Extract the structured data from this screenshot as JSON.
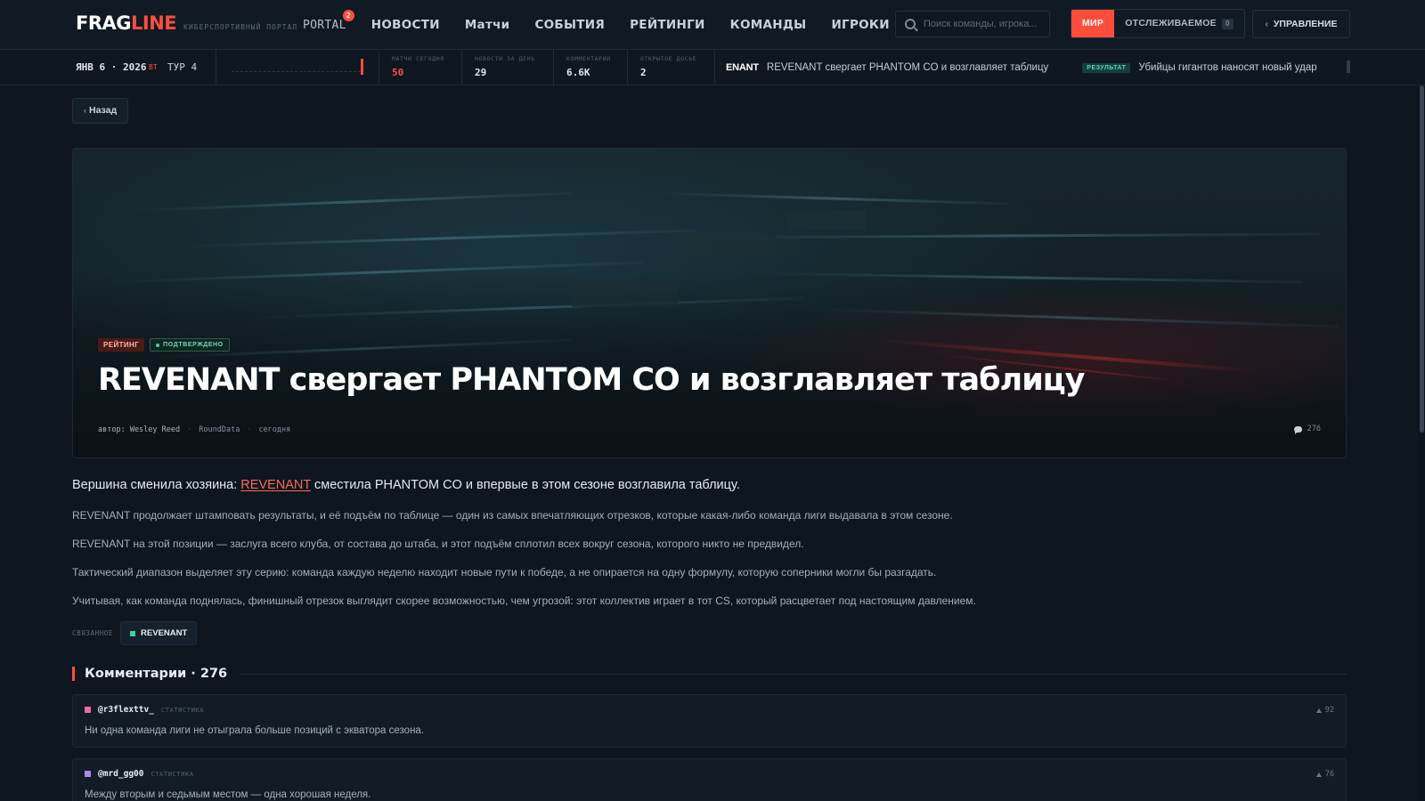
{
  "brand": {
    "name_part1": "FRAG",
    "name_part2": "LINE",
    "subtitle": "киберспортивный портал",
    "accent_color": "#ff4d3d"
  },
  "nav": {
    "items": [
      {
        "label": "PORTAL",
        "badge": "2"
      },
      {
        "label": "НОВОСТИ"
      },
      {
        "label": "Матчи"
      },
      {
        "label": "СОБЫТИЯ"
      },
      {
        "label": "РЕЙТИНГИ"
      },
      {
        "label": "КОМАНДЫ"
      },
      {
        "label": "ИГРОКИ"
      }
    ]
  },
  "search": {
    "placeholder": "Поиск команды, игрока..."
  },
  "scope": {
    "world": "МИР",
    "tracked": "ОТСЛЕЖИВАЕМОЕ",
    "tracked_count": "0"
  },
  "manage": {
    "label": "УПРАВЛЕНИЕ"
  },
  "ticker": {
    "date": "ЯНВ 6 · 2026",
    "weekday": "ВТ",
    "round": "ТУР 4",
    "stats": [
      {
        "label": "матчи сегодня",
        "value": "50"
      },
      {
        "label": "новости за день",
        "value": "29"
      },
      {
        "label": "комментарии",
        "value": "6.6K"
      },
      {
        "label": "открытое досье",
        "value": "2"
      }
    ],
    "news": [
      {
        "team": "ENANT",
        "text": "REVENANT свергает PHANTOM CO и возглавляет таблицу"
      },
      {
        "badge": "РЕЗУЛЬТАТ",
        "text": "Убийцы гигантов наносят новый удар"
      }
    ]
  },
  "back": {
    "label": "Назад"
  },
  "article": {
    "tag_primary": "РЕЙТИНГ",
    "tag_status": "ПОДТВЕРЖДЕНО",
    "title": "REVENANT свергает PHANTOM CO и возглавляет таблицу",
    "author": "автор: Wesley Reed",
    "source": "RoundData",
    "date": "сегодня",
    "comment_count": "276",
    "lead_before": "Вершина сменила хозяина: ",
    "lead_link": "REVENANT",
    "lead_after": " сместила PHANTOM CO и впервые в этом сезоне возглавила таблицу.",
    "paragraphs": [
      "REVENANT продолжает штамповать результаты, и её подъём по таблице — один из самых впечатляющих отрезков, которые какая-либо команда лиги выдавала в этом сезоне.",
      "REVENANT на этой позиции — заслуга всего клуба, от состава до штаба, и этот подъём сплотил всех вокруг сезона, которого никто не предвидел.",
      "Тактический диапазон выделяет эту серию: команда каждую неделю находит новые пути к победе, а не опирается на одну формулу, которую соперники могли бы разгадать.",
      "Учитывая, как команда поднялась, финишный отрезок выглядит скорее возможностью, чем угрозой: этот коллектив играет в тот CS, который расцветает под настоящим давлением."
    ],
    "related_label": "связанное",
    "related_team": "REVENANT",
    "related_color": "#3fd09e"
  },
  "comments": {
    "title": "Комментарии · 276",
    "items": [
      {
        "user": "@r3flexttv_",
        "role": "статистика",
        "votes": "92",
        "text": "Ни одна команда лиги не отыграла больше позиций с экватора сезона.",
        "color": "#e86aa8"
      },
      {
        "user": "@mrd_gg00",
        "role": "статистика",
        "votes": "76",
        "text": "Между вторым и седьмым местом — одна хорошая неделя.",
        "color": "#a98ae8"
      }
    ]
  }
}
